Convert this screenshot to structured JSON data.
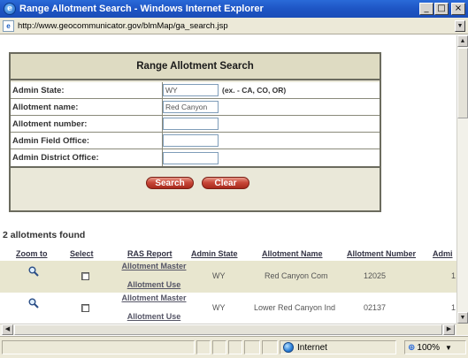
{
  "window": {
    "title": "Range Allotment Search - Windows Internet Explorer",
    "url": "http://www.geocommunicator.gov/blmMap/ga_search.jsp",
    "minimize": "_",
    "maximize": "□",
    "close": "×"
  },
  "search": {
    "title": "Range Allotment Search",
    "fields": [
      {
        "label": "Admin State:",
        "value": "WY",
        "hint": "(ex. - CA, CO, OR)"
      },
      {
        "label": "Allotment name:",
        "value": "Red Canyon",
        "hint": ""
      },
      {
        "label": "Allotment number:",
        "value": "",
        "hint": ""
      },
      {
        "label": "Admin Field Office:",
        "value": "",
        "hint": ""
      },
      {
        "label": "Admin District Office:",
        "value": "",
        "hint": ""
      }
    ],
    "search_button": "Search",
    "clear_button": "Clear"
  },
  "results": {
    "count_text": "2 allotments found",
    "columns": [
      "Zoom to",
      "Select",
      "RAS Report",
      "Admin State",
      "Allotment Name",
      "Allotment Number",
      "Admi"
    ],
    "rows": [
      {
        "ras_report": [
          "Allotment Master",
          "Allotment Use"
        ],
        "admin_state": "WY",
        "allotment_name": "Red Canyon Com",
        "allotment_number": "12025",
        "admin_trunc": "1"
      },
      {
        "ras_report": [
          "Allotment Master",
          "Allotment Use"
        ],
        "admin_state": "WY",
        "allotment_name": "Lower Red Canyon Ind",
        "allotment_number": "02137",
        "admin_trunc": "1"
      }
    ]
  },
  "status": {
    "zone": "Internet",
    "zoom": "100%"
  },
  "icons": {
    "zoom": "magnifier-icon",
    "globe": "globe-icon",
    "ie": "ie-logo-icon"
  },
  "colors": {
    "titlebar": "#1e55c4",
    "panel_bg": "#eae8d9",
    "row_highlight": "#e8e6cf",
    "button_red": "#c9483a"
  }
}
